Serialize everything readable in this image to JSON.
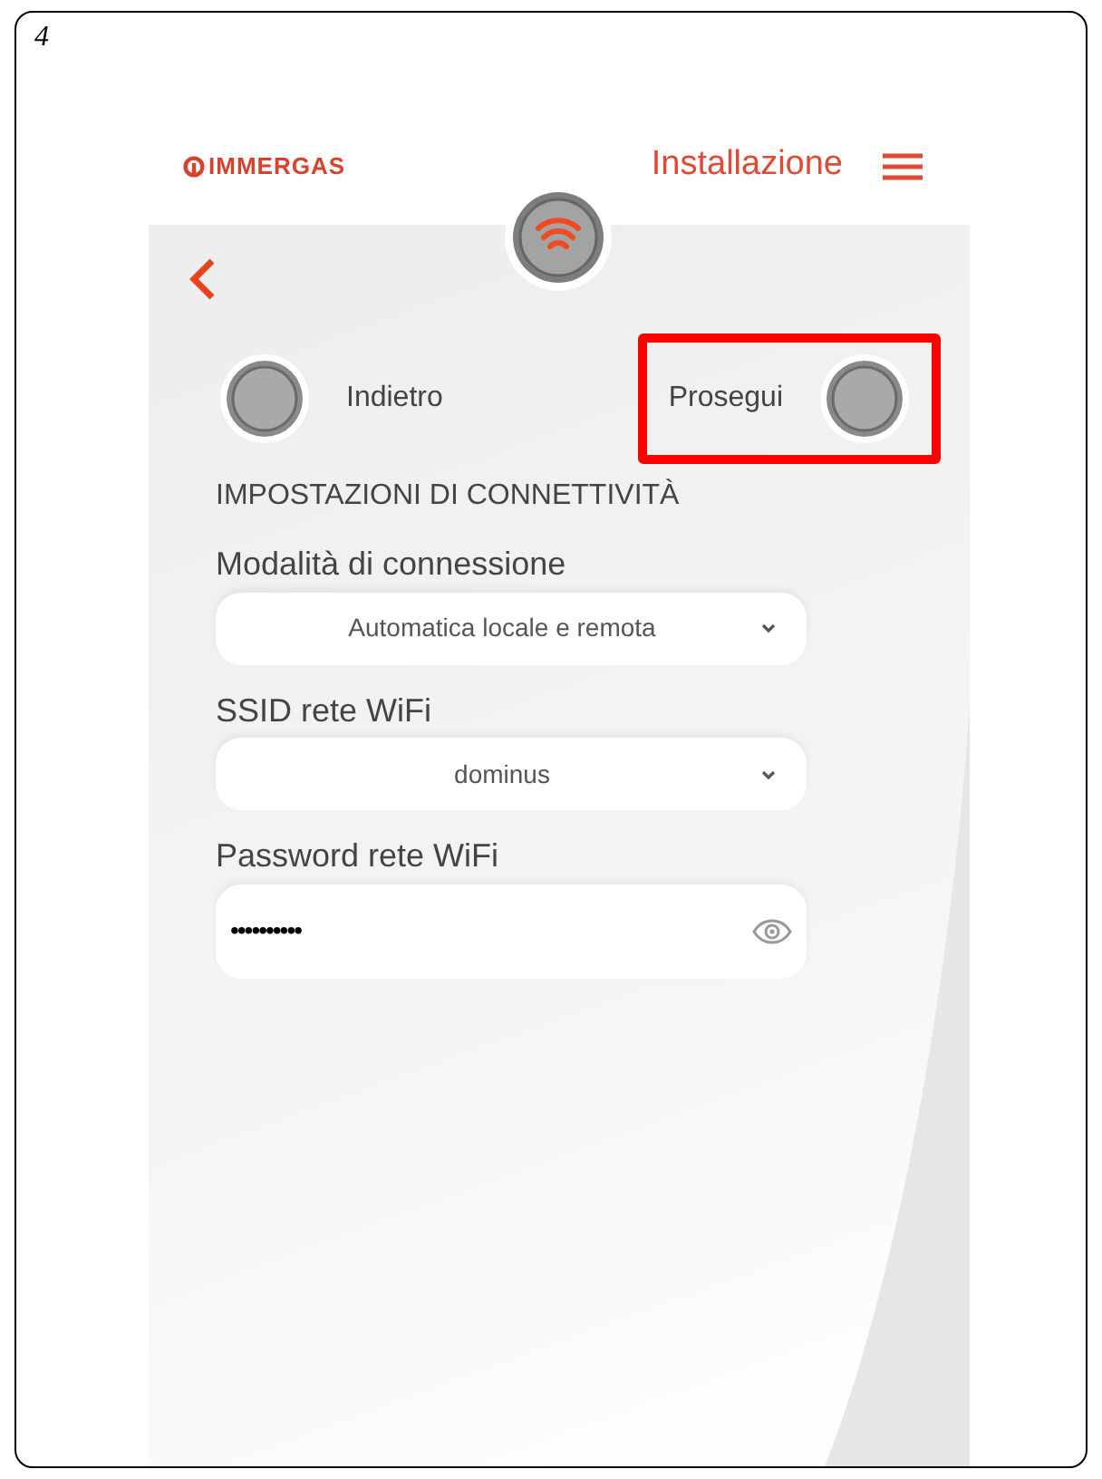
{
  "page_number": "4",
  "header": {
    "logo": "IMMERGAS",
    "title": "Installazione"
  },
  "nav_buttons": [
    {
      "label": "Indietro",
      "kind": "back",
      "highlighted": false
    },
    {
      "label": "Prosegui",
      "kind": "next",
      "highlighted": true
    }
  ],
  "section_title": "IMPOSTAZIONI DI CONNETTIVITÀ",
  "fields": [
    {
      "kind": "select",
      "label": "Modalità di connessione",
      "value": "Automatica locale e remota"
    },
    {
      "kind": "select",
      "label": "SSID rete WiFi",
      "value": "dominus"
    },
    {
      "kind": "password",
      "label": "Password rete WiFi",
      "value": "••••••••••"
    }
  ]
}
